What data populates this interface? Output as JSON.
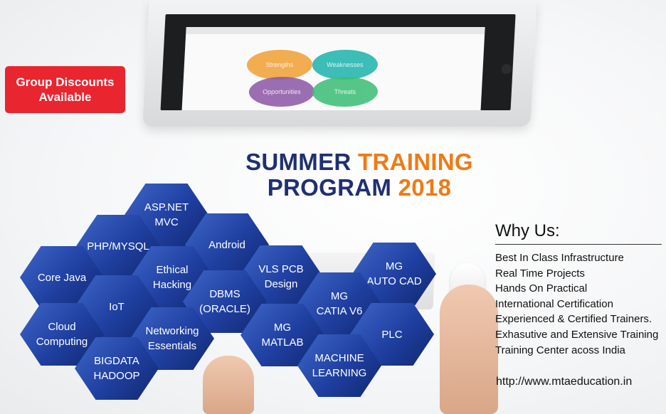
{
  "badge": {
    "line1": "Group Discounts",
    "line2": "Available"
  },
  "monitor": {
    "swot": {
      "strengths": "Strengths",
      "weaknesses": "Weaknesses",
      "opportunities": "Opportunities",
      "threats": "Threats"
    }
  },
  "title": {
    "summer": "SUMMER",
    "training": "TRAINING",
    "program": "PROGRAM",
    "year": "2018"
  },
  "hexagons": [
    {
      "lines": [
        "ASP.NET",
        "MVC"
      ]
    },
    {
      "lines": [
        "PHP/MYSQL"
      ]
    },
    {
      "lines": [
        "Android"
      ]
    },
    {
      "lines": [
        "Core Java"
      ]
    },
    {
      "lines": [
        "Ethical",
        "Hacking"
      ]
    },
    {
      "lines": [
        "VLS PCB",
        "Design"
      ]
    },
    {
      "lines": [
        "MG",
        "AUTO CAD"
      ]
    },
    {
      "lines": [
        "IoT"
      ]
    },
    {
      "lines": [
        "DBMS",
        "(ORACLE)"
      ]
    },
    {
      "lines": [
        "MG",
        "CATIA V6"
      ]
    },
    {
      "lines": [
        "Cloud",
        "Computing"
      ]
    },
    {
      "lines": [
        "Networking",
        "Essentials"
      ]
    },
    {
      "lines": [
        "MG",
        "MATLAB"
      ]
    },
    {
      "lines": [
        "PLC"
      ]
    },
    {
      "lines": [
        "BIGDATA",
        "HADOOP"
      ]
    },
    {
      "lines": [
        "MACHINE",
        "LEARNING"
      ]
    }
  ],
  "why_us": {
    "heading": "Why Us:",
    "items": [
      "Best In Class Infrastructure",
      "Real Time Projects",
      "Hands On Practical",
      "International Certification",
      "Experienced & Certified Trainers.",
      "Exhasutive and Extensive Training",
      "Training Center acoss India"
    ]
  },
  "url": "http://www.mtaeducation.in"
}
